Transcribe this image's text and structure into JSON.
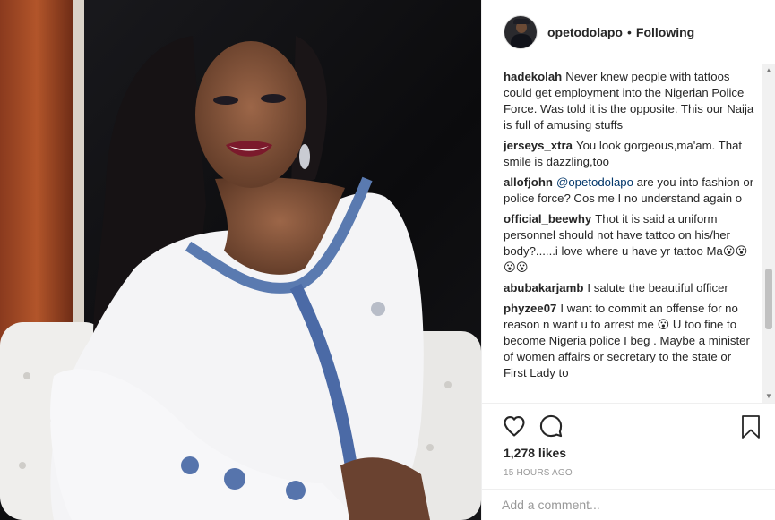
{
  "post": {
    "username": "opetodolapo",
    "separator": "•",
    "follow_status": "Following"
  },
  "comments": [
    {
      "user": "hadekolah",
      "text": "Never knew people with tattoos could get employment into the Nigerian Police Force. Was told it is the opposite. This our Naija is full of amusing stuffs"
    },
    {
      "user": "jerseys_xtra",
      "text": "You look gorgeous,ma'am. That smile is dazzling,too"
    },
    {
      "user": "allofjohn",
      "mention": "@opetodolapo",
      "text": "are you into fashion or police force? Cos me I no understand again o"
    },
    {
      "user": "official_beewhy",
      "text": "Thot it is said a uniform personnel should not have tattoo on his/her body?......i love where u have yr tattoo Ma😮😮😮😮"
    },
    {
      "user": "abubakarjamb",
      "text": "I salute the beautiful officer"
    },
    {
      "user": "phyzee07",
      "text": "I want to commit an offense for no reason n want u to arrest me 😮 U too fine to become Nigeria police I beg . Maybe a minister of women affairs or secretary to the state or First Lady to"
    }
  ],
  "icons": {
    "like": "heart-icon",
    "comment": "comment-bubble-icon",
    "save": "bookmark-icon",
    "scroll_up": "▲",
    "scroll_down": "▼"
  },
  "likes": "1,278 likes",
  "timestamp": "15 HOURS AGO",
  "add_comment": {
    "placeholder": "Add a comment...",
    "value": ""
  },
  "colors": {
    "text": "#262626",
    "muted": "#999999",
    "mention": "#003569",
    "border": "#efefef"
  }
}
